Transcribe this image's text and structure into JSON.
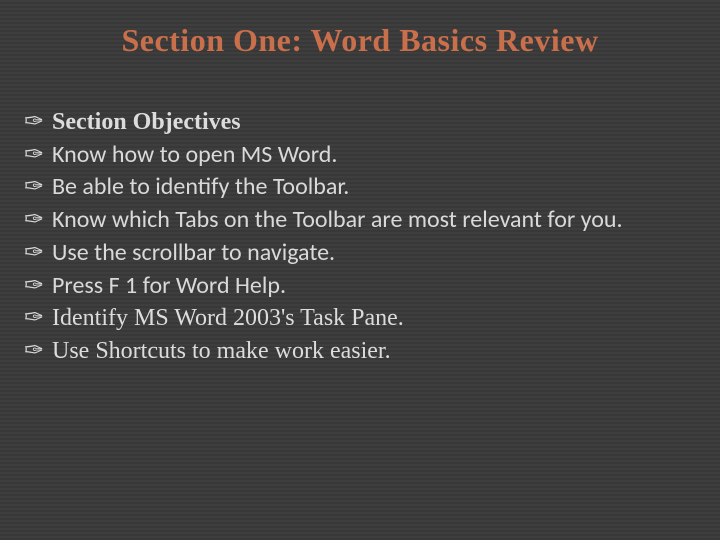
{
  "title": "Section One: Word Basics Review",
  "objectives_heading": "Section Objectives",
  "items": [
    "Know how to open MS Word.",
    "Be able to identify the Toolbar.",
    "Know which Tabs on the Toolbar are most relevant for you.",
    "Use the scrollbar to navigate.",
    "Press F 1 for Word Help.",
    "Identify MS Word 2003's Task Pane.",
    "Use Shortcuts to make work easier."
  ],
  "bullet_glyph": "✑"
}
